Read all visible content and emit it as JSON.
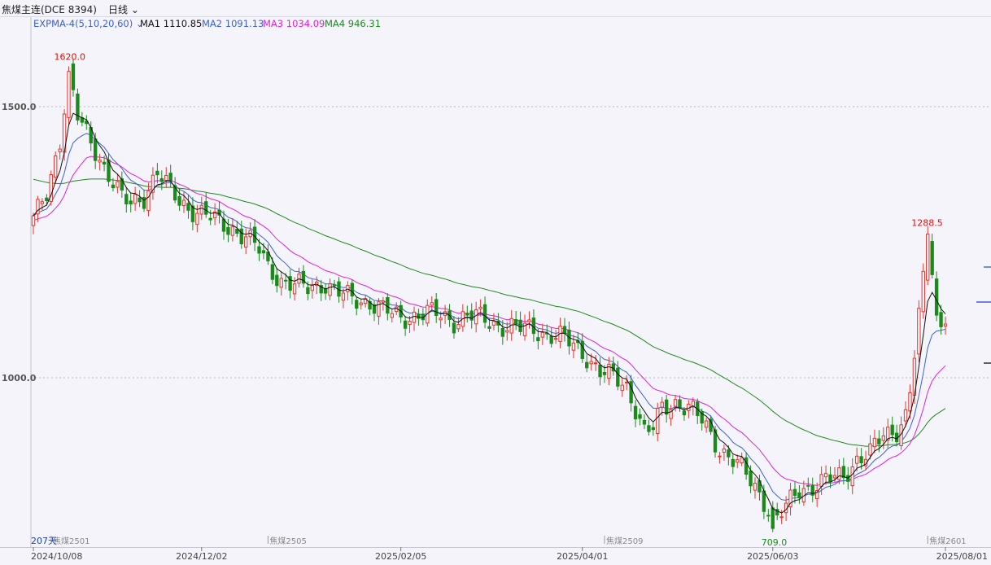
{
  "header": {
    "title": "焦煤主连(DCE 8394)",
    "period": "日线"
  },
  "legend": {
    "name": "EXPMA-4(5,10,20,60)",
    "ma1_label": "MA1",
    "ma1_value": "1110.85",
    "ma2_label": "MA2",
    "ma2_value": "1091.13",
    "ma3_label": "MA3",
    "ma3_value": "1034.09",
    "ma4_label": "MA4",
    "ma4_value": "946.31"
  },
  "annotations": {
    "high": "1620.0",
    "high2": "1288.5",
    "low": "709.0",
    "days": "207天"
  },
  "contracts": [
    "焦煤2501",
    "焦煤2505",
    "焦煤2509",
    "焦煤2601"
  ],
  "colors": {
    "up": "#e8352d",
    "down": "#1a8a1a",
    "ma1": "#111111",
    "ma2": "#3a62d8",
    "ma3": "#e020e0",
    "ma4": "#1f8a1f",
    "grid": "#b8b8c8",
    "axis_text": "#555555"
  },
  "chart_data": {
    "type": "candlestick",
    "y_ticks": [
      "1500.0",
      "1000.0"
    ],
    "x_ticks": [
      "2024/10/08",
      "2024/12/02",
      "2025/02/05",
      "2025/04/01",
      "2025/06/03",
      "2025/08/01"
    ],
    "ylim": [
      700,
      1720
    ],
    "num_days": 207,
    "anchors": [
      [
        0,
        1290
      ],
      [
        3,
        1340
      ],
      [
        6,
        1440
      ],
      [
        8,
        1560
      ],
      [
        10,
        1480
      ],
      [
        12,
        1450
      ],
      [
        14,
        1420
      ],
      [
        16,
        1390
      ],
      [
        18,
        1360
      ],
      [
        20,
        1330
      ],
      [
        22,
        1320
      ],
      [
        25,
        1335
      ],
      [
        28,
        1380
      ],
      [
        30,
        1355
      ],
      [
        33,
        1325
      ],
      [
        36,
        1310
      ],
      [
        39,
        1300
      ],
      [
        42,
        1285
      ],
      [
        45,
        1275
      ],
      [
        48,
        1260
      ],
      [
        51,
        1235
      ],
      [
        53,
        1205
      ],
      [
        56,
        1180
      ],
      [
        59,
        1170
      ],
      [
        62,
        1165
      ],
      [
        66,
        1175
      ],
      [
        68,
        1160
      ],
      [
        72,
        1145
      ],
      [
        76,
        1140
      ],
      [
        79,
        1125
      ],
      [
        83,
        1110
      ],
      [
        86,
        1115
      ],
      [
        89,
        1120
      ],
      [
        92,
        1115
      ],
      [
        95,
        1105
      ],
      [
        98,
        1115
      ],
      [
        101,
        1110
      ],
      [
        104,
        1100
      ],
      [
        107,
        1095
      ],
      [
        110,
        1090
      ],
      [
        113,
        1090
      ],
      [
        116,
        1080
      ],
      [
        119,
        1075
      ],
      [
        122,
        1060
      ],
      [
        125,
        1040
      ],
      [
        128,
        1010
      ],
      [
        131,
        1000
      ],
      [
        134,
        985
      ],
      [
        136,
        945
      ],
      [
        138,
        900
      ],
      [
        140,
        905
      ],
      [
        142,
        945
      ],
      [
        145,
        955
      ],
      [
        148,
        945
      ],
      [
        151,
        920
      ],
      [
        155,
        870
      ],
      [
        159,
        840
      ],
      [
        163,
        800
      ],
      [
        166,
        760
      ],
      [
        168,
        740
      ],
      [
        170,
        760
      ],
      [
        173,
        795
      ],
      [
        176,
        800
      ],
      [
        179,
        810
      ],
      [
        183,
        820
      ],
      [
        186,
        850
      ],
      [
        189,
        860
      ],
      [
        192,
        895
      ],
      [
        195,
        905
      ],
      [
        197,
        930
      ],
      [
        198,
        975
      ],
      [
        199,
        1040
      ],
      [
        200,
        1110
      ],
      [
        201,
        1180
      ],
      [
        202,
        1255
      ],
      [
        203,
        1200
      ],
      [
        204,
        1110
      ],
      [
        205,
        1100
      ],
      [
        206,
        1120
      ]
    ],
    "series": [
      {
        "name": "MA1",
        "value": 1110.85
      },
      {
        "name": "MA2",
        "value": 1091.13
      },
      {
        "name": "MA3",
        "value": 1034.09
      },
      {
        "name": "MA4",
        "value": 946.31
      }
    ]
  }
}
